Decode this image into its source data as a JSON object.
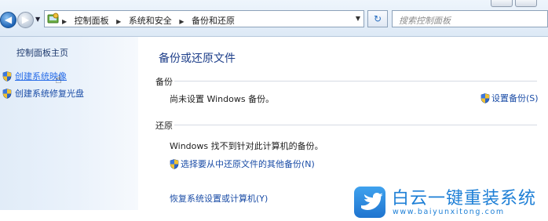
{
  "window": {
    "breadcrumb": [
      "控制面板",
      "系统和安全",
      "备份和还原"
    ],
    "search_placeholder": "搜索控制面板"
  },
  "sidebar": {
    "home_label": "控制面板主页",
    "links": [
      {
        "label": "创建系统映像",
        "icon": "uac-shield-icon",
        "active": true
      },
      {
        "label": "创建系统修复光盘",
        "icon": "uac-shield-icon",
        "active": false
      }
    ]
  },
  "main": {
    "title": "备份或还原文件",
    "backup": {
      "heading": "备份",
      "status": "尚未设置 Windows 备份。",
      "setup_link": "设置备份(S)"
    },
    "restore": {
      "heading": "还原",
      "status": "Windows 找不到针对此计算机的备份。",
      "other_backup_link": "选择要从中还原文件的其他备份(N)",
      "recover_link": "恢复系统设置或计算机(Y)"
    }
  },
  "watermark": {
    "title": "白云一键重装系统",
    "url": "www.baiyunxitong.com",
    "icon": "bird-logo-icon"
  },
  "colors": {
    "link": "#1a4ca6",
    "title": "#1e3f8a",
    "watermark": "#1d7fd6"
  }
}
